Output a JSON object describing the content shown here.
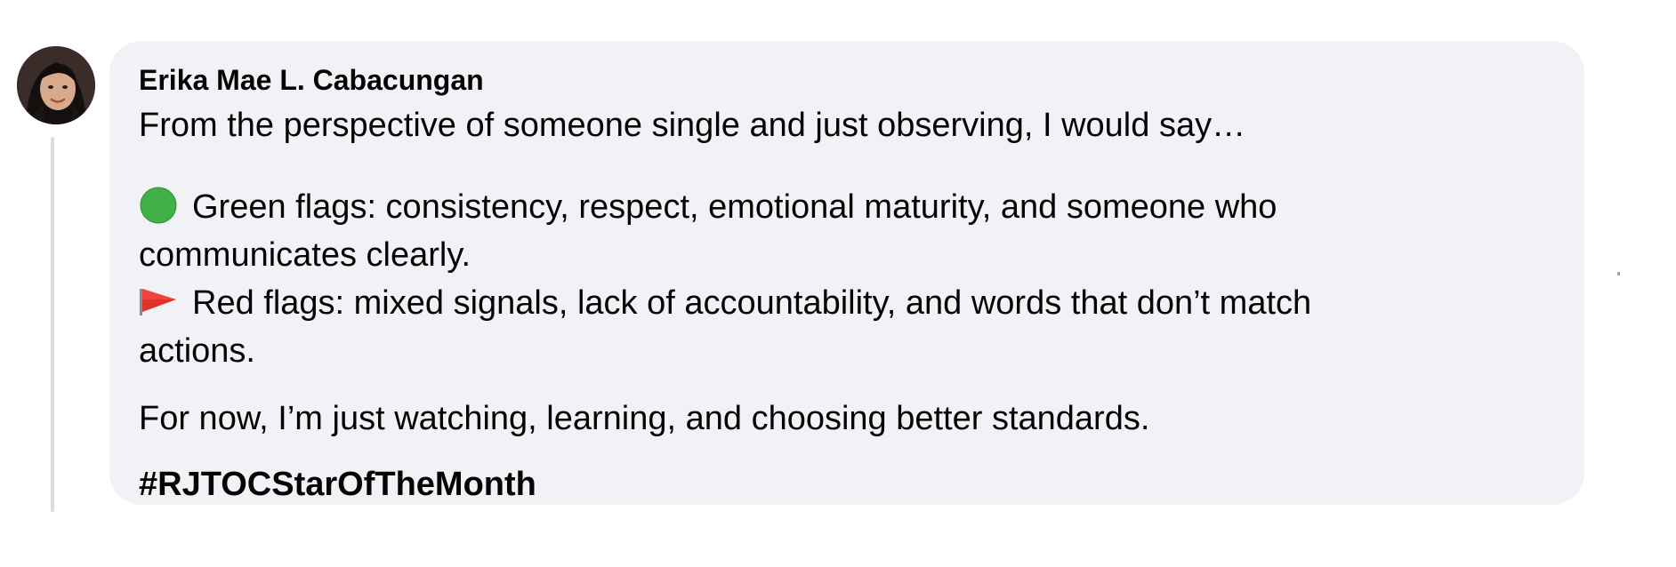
{
  "comment": {
    "author": "Erika Mae L. Cabacungan",
    "intro": "From the perspective of someone single and just observing, I would say…",
    "green_line1": "Green flags: consistency, respect, emotional maturity, and someone who",
    "green_line2": "communicates clearly.",
    "red_line1": "Red flags: mixed signals, lack of accountability, and words that don’t match",
    "red_line2": "actions.",
    "closing": "For now, I’m just watching, learning, and choosing better standards.",
    "hashtag": "#RJTOCStarOfTheMonth"
  },
  "icons": {
    "green_bullet": "green-circle-emoji",
    "red_bullet": "triangular-flag-emoji"
  },
  "colors": {
    "bubble_bg": "#f0f2f5",
    "thread_line": "#dadde1",
    "text": "#050505",
    "green_emoji": "#43b047",
    "red_flag": "#e0312b"
  }
}
